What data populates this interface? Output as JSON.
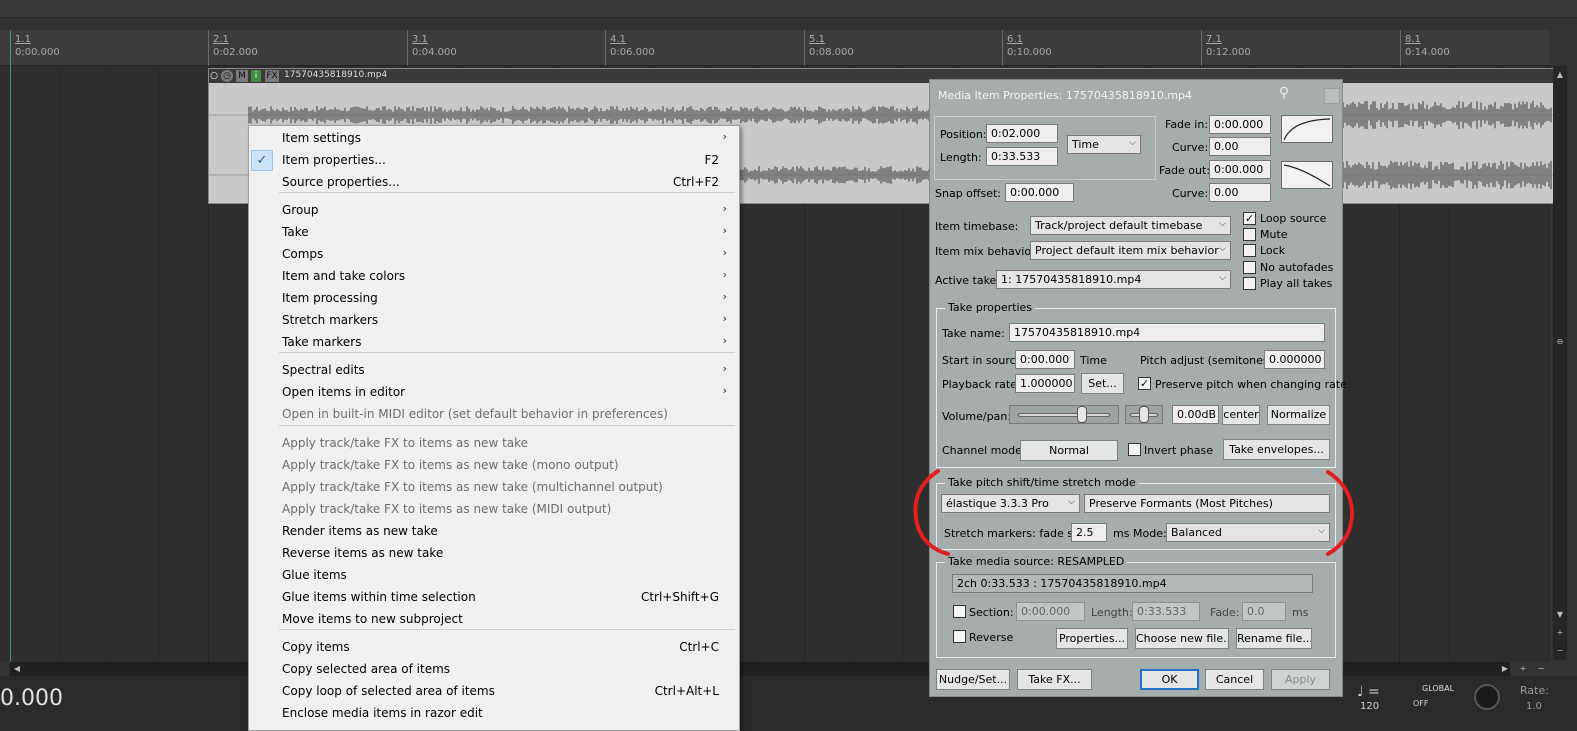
{
  "ruler": {
    "marks": [
      {
        "measure": "1.1",
        "time": "0:00.000"
      },
      {
        "measure": "2.1",
        "time": "0:02.000"
      },
      {
        "measure": "3.1",
        "time": "0:04.000"
      },
      {
        "measure": "4.1",
        "time": "0:06.000"
      },
      {
        "measure": "5.1",
        "time": "0:08.000"
      },
      {
        "measure": "6.1",
        "time": "0:10.000"
      },
      {
        "measure": "7.1",
        "time": "0:12.000"
      },
      {
        "measure": "8.1",
        "time": "0:14.000"
      }
    ]
  },
  "media_item": {
    "name": "17570435818910.mp4",
    "icons": [
      "M",
      "i",
      "FX"
    ]
  },
  "context_menu": {
    "items": [
      {
        "label": "Item settings",
        "accel": "",
        "submenu": true,
        "checked": false,
        "disabled": false
      },
      {
        "label": "Item properties...",
        "accel": "F2",
        "submenu": false,
        "checked": true,
        "disabled": false
      },
      {
        "label": "Source properties...",
        "accel": "Ctrl+F2",
        "submenu": false,
        "checked": false,
        "disabled": false
      },
      {
        "label": "Group",
        "accel": "",
        "submenu": true,
        "checked": false,
        "disabled": false
      },
      {
        "label": "Take",
        "accel": "",
        "submenu": true,
        "checked": false,
        "disabled": false
      },
      {
        "label": "Comps",
        "accel": "",
        "submenu": true,
        "checked": false,
        "disabled": false
      },
      {
        "label": "Item and take colors",
        "accel": "",
        "submenu": true,
        "checked": false,
        "disabled": false
      },
      {
        "label": "Item processing",
        "accel": "",
        "submenu": true,
        "checked": false,
        "disabled": false
      },
      {
        "label": "Stretch markers",
        "accel": "",
        "submenu": true,
        "checked": false,
        "disabled": false
      },
      {
        "label": "Take markers",
        "accel": "",
        "submenu": true,
        "checked": false,
        "disabled": false
      },
      {
        "label": "Spectral edits",
        "accel": "",
        "submenu": true,
        "checked": false,
        "disabled": false
      },
      {
        "label": "Open items in editor",
        "accel": "",
        "submenu": true,
        "checked": false,
        "disabled": false
      },
      {
        "label": "Open in built-in MIDI editor (set default behavior in preferences)",
        "accel": "",
        "submenu": false,
        "checked": false,
        "disabled": true
      },
      {
        "label": "Apply track/take FX to items as new take",
        "accel": "",
        "submenu": false,
        "checked": false,
        "disabled": true
      },
      {
        "label": "Apply track/take FX to items as new take (mono output)",
        "accel": "",
        "submenu": false,
        "checked": false,
        "disabled": true
      },
      {
        "label": "Apply track/take FX to items as new take (multichannel output)",
        "accel": "",
        "submenu": false,
        "checked": false,
        "disabled": true
      },
      {
        "label": "Apply track/take FX to items as new take (MIDI output)",
        "accel": "",
        "submenu": false,
        "checked": false,
        "disabled": true
      },
      {
        "label": "Render items as new take",
        "accel": "",
        "submenu": false,
        "checked": false,
        "disabled": false
      },
      {
        "label": "Reverse items as new take",
        "accel": "",
        "submenu": false,
        "checked": false,
        "disabled": false
      },
      {
        "label": "Glue items",
        "accel": "",
        "submenu": false,
        "checked": false,
        "disabled": false
      },
      {
        "label": "Glue items within time selection",
        "accel": "Ctrl+Shift+G",
        "submenu": false,
        "checked": false,
        "disabled": false
      },
      {
        "label": "Move items to new subproject",
        "accel": "",
        "submenu": false,
        "checked": false,
        "disabled": false
      },
      {
        "label": "Copy items",
        "accel": "Ctrl+C",
        "submenu": false,
        "checked": false,
        "disabled": false
      },
      {
        "label": "Copy selected area of items",
        "accel": "",
        "submenu": false,
        "checked": false,
        "disabled": false
      },
      {
        "label": "Copy loop of selected area of items",
        "accel": "Ctrl+Alt+L",
        "submenu": false,
        "checked": false,
        "disabled": false
      },
      {
        "label": "Enclose media items in razor edit",
        "accel": "",
        "submenu": false,
        "checked": false,
        "disabled": false
      }
    ]
  },
  "dialog": {
    "title": "Media Item Properties:  17570435818910.mp4",
    "position_label": "Position:",
    "position_value": "0:02.000",
    "length_label": "Length:",
    "length_value": "0:33.533",
    "time_mode": "Time",
    "fade_in_label": "Fade in:",
    "fade_in_value": "0:00.000",
    "curve_label": "Curve:",
    "curve_in_value": "0.00",
    "fade_out_label": "Fade out:",
    "fade_out_value": "0:00.000",
    "curve_out_value": "0.00",
    "snap_offset_label": "Snap offset:",
    "snap_offset_value": "0:00.000",
    "item_timebase_label": "Item timebase:",
    "item_timebase_value": "Track/project default timebase",
    "item_mix_label": "Item mix behavior:",
    "item_mix_value": "Project default item mix behavior",
    "active_take_label": "Active take:",
    "active_take_value": "1: 17570435818910.mp4",
    "checkboxes": {
      "loop_source": "Loop source",
      "mute": "Mute",
      "lock": "Lock",
      "no_autofades": "No autofades",
      "play_all_takes": "Play all takes"
    },
    "take_props_title": "Take properties",
    "take_name_label": "Take name:",
    "take_name_value": "17570435818910.mp4",
    "start_in_source_label": "Start in source:",
    "start_in_source_value": "0:00.000",
    "start_in_source_unit": "Time",
    "pitch_adjust_label": "Pitch adjust (semitones):",
    "pitch_adjust_value": "0.000000",
    "playback_rate_label": "Playback rate:",
    "playback_rate_value": "1.000000",
    "set_button": "Set...",
    "preserve_pitch_label": "Preserve pitch when changing rate",
    "volume_pan_label": "Volume/pan:",
    "volume_value": "0.00dB",
    "center_button": "center",
    "normalize_button": "Normalize",
    "channel_mode_label": "Channel mode:",
    "channel_mode_value": "Normal",
    "invert_phase_label": "Invert phase",
    "take_envelopes_button": "Take envelopes...",
    "pitch_shift_title": "Take pitch shift/time stretch mode",
    "pitch_shift_algo": "élastique 3.3.3 Pro",
    "pitch_shift_mode": "Preserve Formants (Most Pitches)",
    "stretch_markers_label": "Stretch markers: fade size:",
    "fade_size_value": "2.5",
    "fade_size_unit": "ms",
    "mode_label": "Mode:",
    "mode_value": "Balanced",
    "media_source_title": "Take media source:  RESAMPLED",
    "media_source_value": "2ch 0:33.533 : 17570435818910.mp4",
    "section_label": "Section:",
    "section_start": "0:00.000",
    "section_length_label": "Length:",
    "section_length": "0:33.533",
    "section_fade_label": "Fade:",
    "section_fade": "0.0",
    "section_fade_unit": "ms",
    "reverse_label": "Reverse",
    "properties_button": "Properties...",
    "choose_new_file_button": "Choose new file...",
    "rename_file_button": "Rename file...",
    "nudge_button": "Nudge/Set...",
    "take_fx_button": "Take FX...",
    "ok_button": "OK",
    "cancel_button": "Cancel",
    "apply_button": "Apply"
  },
  "transport": {
    "time": "0.000",
    "bpm": "120",
    "global_label": "GLOBAL",
    "global_state": "OFF",
    "rate_label": "Rate:",
    "rate_value": "1.0"
  },
  "colors": {
    "annotation": "#e0201e",
    "dialog_bg": "#a6adad",
    "menu_bg": "#f0f0f0"
  }
}
